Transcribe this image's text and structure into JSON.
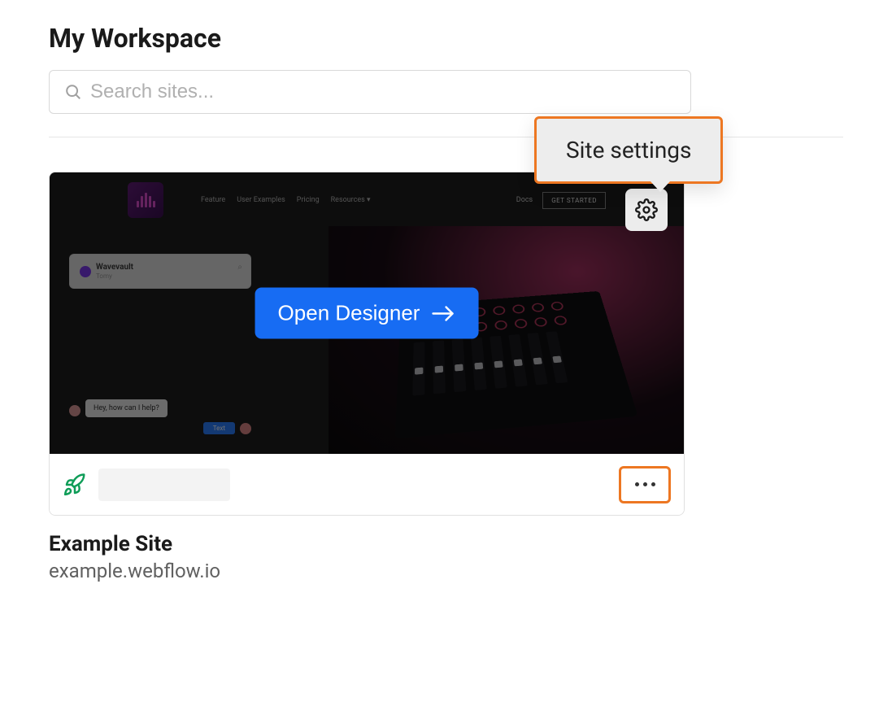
{
  "workspace": {
    "title": "My Workspace"
  },
  "search": {
    "placeholder": "Search sites..."
  },
  "tooltip": {
    "site_settings": "Site settings"
  },
  "site_card": {
    "open_designer_label": "Open Designer",
    "preview_nav": {
      "items": [
        "Feature",
        "User Examples",
        "Pricing",
        "Resources"
      ],
      "right_items": [
        "Docs"
      ],
      "cta": "GET STARTED",
      "brand": "Wavevault",
      "brand_sub": "Tomy",
      "chat_msg": "Hey, how can I help?",
      "chat_send": "Text"
    },
    "name": "Example Site",
    "url": "example.webflow.io"
  },
  "colors": {
    "accent_orange": "#ed7722",
    "primary_blue": "#176cf3",
    "status_green": "#0f9d58"
  }
}
